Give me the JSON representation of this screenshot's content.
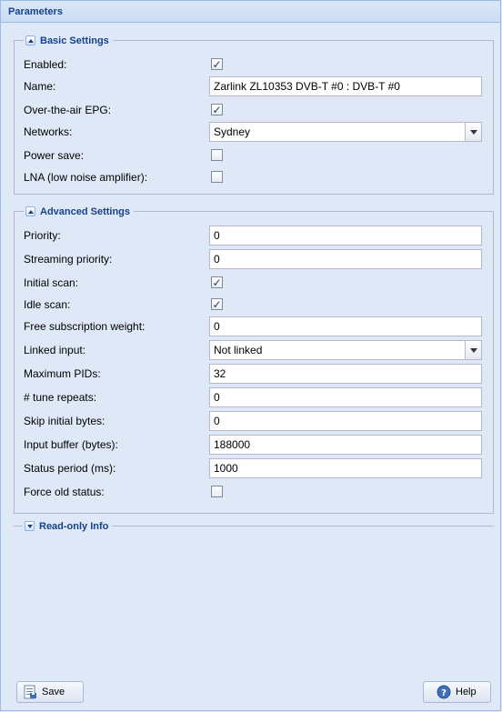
{
  "panel": {
    "title": "Parameters"
  },
  "basic": {
    "title": "Basic Settings",
    "enabled": {
      "label": "Enabled:",
      "checked": true
    },
    "name": {
      "label": "Name:",
      "value": "Zarlink ZL10353 DVB-T #0 : DVB-T #0"
    },
    "epg": {
      "label": "Over-the-air EPG:",
      "checked": true
    },
    "networks": {
      "label": "Networks:",
      "value": "Sydney"
    },
    "power_save": {
      "label": "Power save:",
      "checked": false
    },
    "lna": {
      "label": "LNA (low noise amplifier):",
      "checked": false
    }
  },
  "advanced": {
    "title": "Advanced Settings",
    "priority": {
      "label": "Priority:",
      "value": "0"
    },
    "streaming_priority": {
      "label": "Streaming priority:",
      "value": "0"
    },
    "initial_scan": {
      "label": "Initial scan:",
      "checked": true
    },
    "idle_scan": {
      "label": "Idle scan:",
      "checked": true
    },
    "free_sub_weight": {
      "label": "Free subscription weight:",
      "value": "0"
    },
    "linked_input": {
      "label": "Linked input:",
      "value": "Not linked"
    },
    "max_pids": {
      "label": "Maximum PIDs:",
      "value": "32"
    },
    "tune_repeats": {
      "label": "# tune repeats:",
      "value": "0"
    },
    "skip_bytes": {
      "label": "Skip initial bytes:",
      "value": "0"
    },
    "input_buffer": {
      "label": "Input buffer (bytes):",
      "value": "188000"
    },
    "status_period": {
      "label": "Status period (ms):",
      "value": "1000"
    },
    "force_old_status": {
      "label": "Force old status:",
      "checked": false
    }
  },
  "readonly": {
    "title": "Read-only Info"
  },
  "buttons": {
    "save": "Save",
    "help": "Help"
  },
  "check_glyph": "✓"
}
